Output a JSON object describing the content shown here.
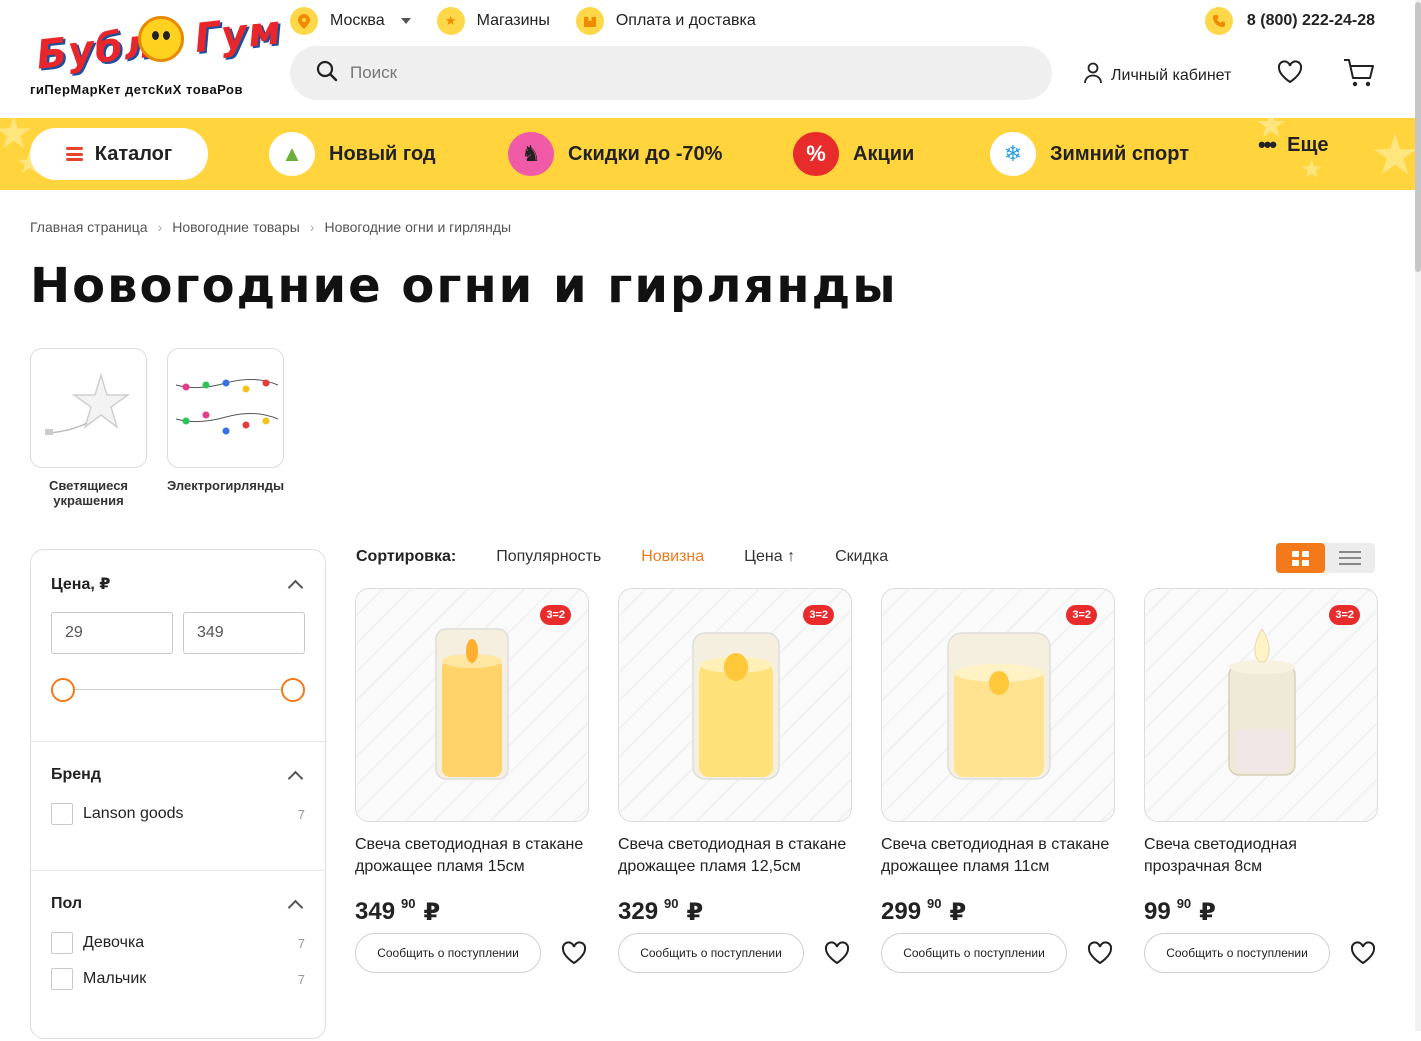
{
  "logo": {
    "word": "Бубль Гум",
    "tagline": "гиПерМарКет детсКиХ товаРов"
  },
  "topnav": {
    "city": "Москва",
    "stores": "Магазины",
    "delivery": "Оплата и доставка",
    "phone": "8 (800) 222-24-28"
  },
  "search": {
    "placeholder": "Поиск"
  },
  "account": {
    "label": "Личный кабинет"
  },
  "catbar": {
    "catalog": "Каталог",
    "items": [
      {
        "label": "Новый год",
        "icon": "tree-icon"
      },
      {
        "label": "Скидки до -70%",
        "icon": "cat-icon"
      },
      {
        "label": "Акции",
        "icon": "percent-icon"
      },
      {
        "label": "Зимний спорт",
        "icon": "snowflake-icon"
      },
      {
        "label": "Еще",
        "icon": "more-icon"
      }
    ]
  },
  "breadcrumbs": [
    "Главная страница",
    "Новогодние товары",
    "Новогодние огни и гирлянды"
  ],
  "page_title": "Новогодние огни и гирлянды",
  "subcategories": [
    {
      "label": "Светящиеся украшения"
    },
    {
      "label": "Электрогирлянды"
    }
  ],
  "filters": {
    "price": {
      "title": "Цена, ₽",
      "min": "29",
      "max": "349"
    },
    "brand": {
      "title": "Бренд",
      "options": [
        {
          "label": "Lanson goods",
          "count": "7"
        }
      ]
    },
    "gender": {
      "title": "Пол",
      "options": [
        {
          "label": "Девочка",
          "count": "7"
        },
        {
          "label": "Мальчик",
          "count": "7"
        }
      ]
    }
  },
  "sort": {
    "label": "Сортировка:",
    "options": [
      "Популярность",
      "Новизна",
      "Цена",
      "Скидка"
    ],
    "active": "Новизна",
    "price_arrow": "↑"
  },
  "products": [
    {
      "title": "Свеча светодиодная в стакане дрожащее пламя 15см",
      "price": "349",
      "kop": "90",
      "currency": "₽",
      "badge": "3=2",
      "notify": "Сообщить о поступлении"
    },
    {
      "title": "Свеча светодиодная в стакане дрожащее пламя 12,5см",
      "price": "329",
      "kop": "90",
      "currency": "₽",
      "badge": "3=2",
      "notify": "Сообщить о поступлении"
    },
    {
      "title": "Свеча светодиодная в стакане дрожащее пламя 11см",
      "price": "299",
      "kop": "90",
      "currency": "₽",
      "badge": "3=2",
      "notify": "Сообщить о поступлении"
    },
    {
      "title": "Свеча светодиодная прозрачная 8см",
      "price": "99",
      "kop": "90",
      "currency": "₽",
      "badge": "3=2",
      "notify": "Сообщить о поступлении"
    }
  ],
  "colors": {
    "accent": "#f27a1a",
    "yellow": "#ffd43d",
    "badge": "#e82c2c"
  }
}
